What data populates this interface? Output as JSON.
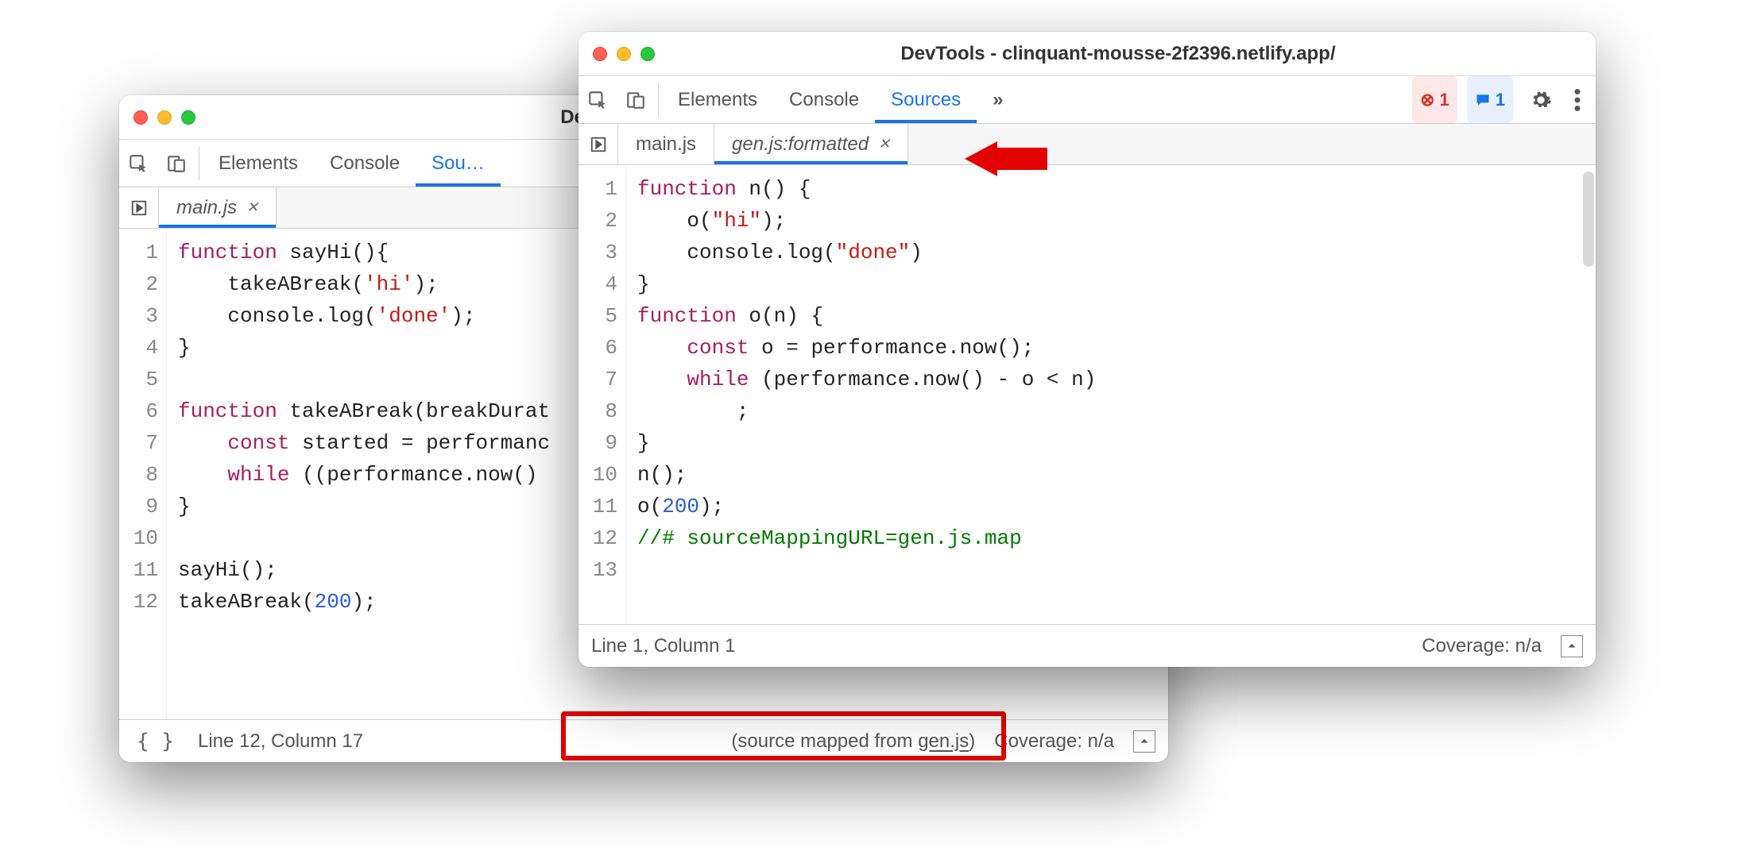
{
  "win1": {
    "title": "DevTools - clinquant-m…",
    "panels": [
      "Elements",
      "Console",
      "Sou…"
    ],
    "activePanel": 2,
    "tabs": [
      {
        "label": "main.js",
        "active": true
      }
    ],
    "code": {
      "lines": [
        "function sayHi(){",
        "    takeABreak('hi');",
        "    console.log('done');",
        "}",
        "",
        "function takeABreak(breakDurat",
        "    const started = performanc",
        "    while ((performance.now() ",
        "}",
        "",
        "sayHi();",
        "takeABreak(200);"
      ]
    },
    "status": {
      "pos": "Line 12, Column 17",
      "mapped_prefix": "(source mapped from ",
      "mapped_link": "gen.js",
      "mapped_suffix": ")",
      "coverage": "Coverage: n/a"
    }
  },
  "win2": {
    "title": "DevTools - clinquant-mousse-2f2396.netlify.app/",
    "panels": [
      "Elements",
      "Console",
      "Sources"
    ],
    "activePanel": 2,
    "more": "»",
    "errCount": "1",
    "msgCount": "1",
    "tabs": [
      {
        "label": "main.js",
        "active": false
      },
      {
        "label": "gen.js:formatted",
        "active": true
      }
    ],
    "code": {
      "lines": [
        "function n() {",
        "    o(\"hi\");",
        "    console.log(\"done\")",
        "}",
        "function o(n) {",
        "    const o = performance.now();",
        "    while (performance.now() - o < n)",
        "        ;",
        "}",
        "n();",
        "o(200);",
        "//# sourceMappingURL=gen.js.map",
        ""
      ]
    },
    "status": {
      "pos": "Line 1, Column 1",
      "coverage": "Coverage: n/a"
    }
  },
  "icons": {
    "errGlyph": "⊗",
    "msgGlyph": "▤"
  }
}
